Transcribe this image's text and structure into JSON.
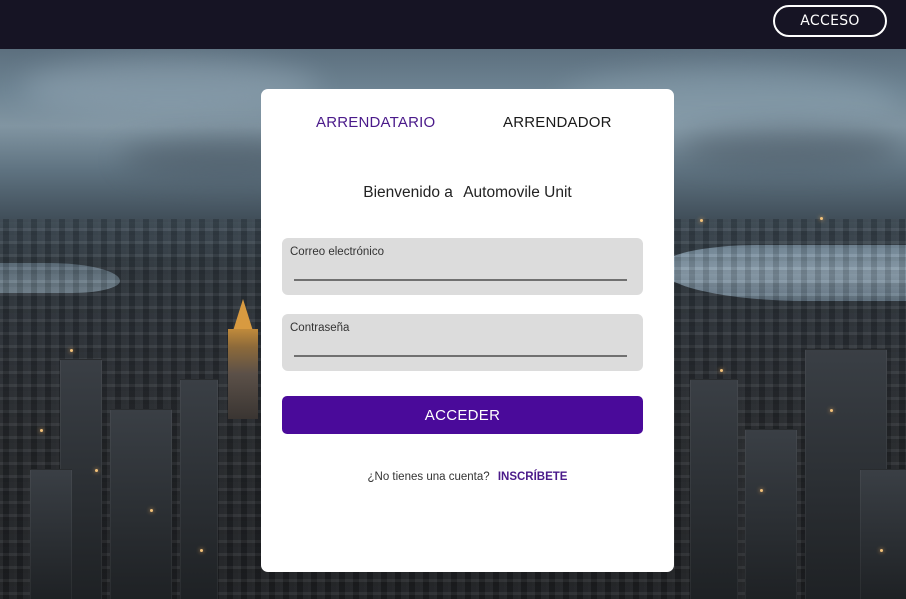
{
  "header": {
    "login_button": "ACCESO"
  },
  "card": {
    "tabs": [
      {
        "label": "ARRENDATARIO",
        "active": true
      },
      {
        "label": "ARRENDADOR",
        "active": false
      }
    ],
    "welcome_prefix": "Bienvenido a",
    "app_name": "Automovile Unit",
    "fields": {
      "email": {
        "label": "Correo electrónico",
        "value": ""
      },
      "password": {
        "label": "Contraseña",
        "value": ""
      }
    },
    "submit_label": "ACCEDER",
    "signup_prompt": "¿No tienes una cuenta?",
    "signup_link": "INSCRÍBETE"
  },
  "colors": {
    "accent": "#4a0a9a",
    "tab_active": "#4a1a8a",
    "topbar": "#161424",
    "card": "#ffffff",
    "field_bg": "#dcdcdc"
  }
}
